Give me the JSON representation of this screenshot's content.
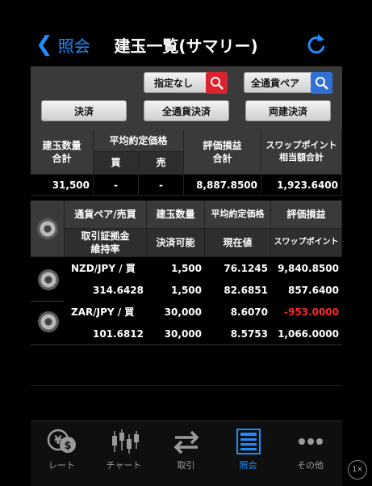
{
  "header": {
    "back_label": "照会",
    "title": "建玉一覧(サマリー)"
  },
  "filters": {
    "order_filter": "指定なし",
    "pair_filter": "全通貨ペア",
    "settle_button": "決済",
    "settle_all_button": "全通貨決済",
    "both_settle_button": "両建決済"
  },
  "summary": {
    "headers": {
      "position_qty": "建玉数量\n合計",
      "avg_price": "平均約定価格",
      "buy": "買",
      "sell": "売",
      "eval_pl": "評価損益\n合計",
      "swap": "スワップポイント\n相当額合計"
    },
    "values": {
      "position_qty": "31,500",
      "buy": "-",
      "sell": "-",
      "eval_pl": "8,887.8500",
      "swap": "1,923.6400"
    }
  },
  "detail": {
    "headers": {
      "pair_side": "通貨ペア/売買",
      "qty": "建玉数量",
      "avg_price": "平均約定価格",
      "eval_pl": "評価損益",
      "margin_ratio": "取引証拠金\n維持率",
      "settleable": "決済可能",
      "current": "現在値",
      "swap": "スワップポイント"
    },
    "rows": [
      {
        "pair": "NZD/JPY / 買",
        "qty": "1,500",
        "avg": "76.1245",
        "pl": "9,840.8500",
        "pl_negative": false,
        "ratio": "314.6428",
        "settle": "1,500",
        "current": "82.6851",
        "swap": "857.6400"
      },
      {
        "pair": "ZAR/JPY / 買",
        "qty": "30,000",
        "avg": "8.6070",
        "pl": "-953.0000",
        "pl_negative": true,
        "ratio": "101.6812",
        "settle": "30,000",
        "current": "8.5753",
        "swap": "1,066.0000"
      }
    ]
  },
  "tabs": [
    {
      "label": "レート",
      "icon": "yen-dollar-icon",
      "active": false
    },
    {
      "label": "チャート",
      "icon": "candlestick-icon",
      "active": false
    },
    {
      "label": "取引",
      "icon": "exchange-arrows-icon",
      "active": false
    },
    {
      "label": "照会",
      "icon": "list-icon",
      "active": true
    },
    {
      "label": "その他",
      "icon": "more-dots-icon",
      "active": false
    }
  ],
  "zoom_badge": "1×",
  "colors": {
    "accent": "#1e8cff",
    "negative": "#ff2a2a",
    "header_bg": "#3a3a3a"
  }
}
